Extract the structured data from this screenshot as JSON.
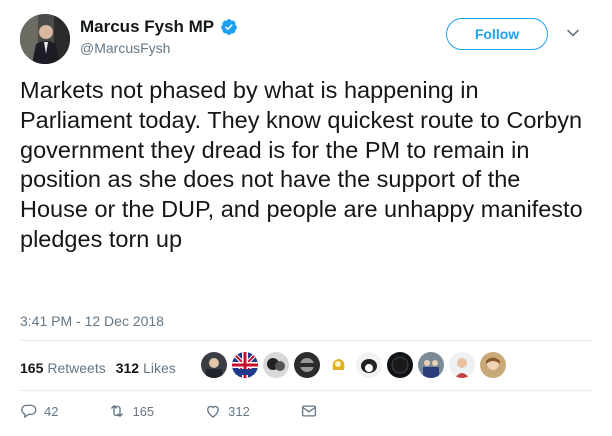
{
  "author": {
    "name": "Marcus Fysh MP",
    "handle": "@MarcusFysh"
  },
  "follow_label": "Follow",
  "tweet": {
    "text": "Markets not phased by what is happening in Parliament today. They know quickest route to Corbyn government they dread is for the PM to remain in position as she does not have the support of the House or the DUP, and people are unhappy manifesto pledges torn up",
    "timestamp": "3:41 PM - 12 Dec 2018"
  },
  "stats": {
    "retweets_count": "165",
    "retweets_label": "Retweets",
    "likes_count": "312",
    "likes_label": "Likes"
  },
  "actions": {
    "replies": "42",
    "retweets": "165",
    "likes": "312"
  },
  "colors": {
    "accent": "#1da1f2",
    "text": "#14171a",
    "muted": "#657786"
  }
}
